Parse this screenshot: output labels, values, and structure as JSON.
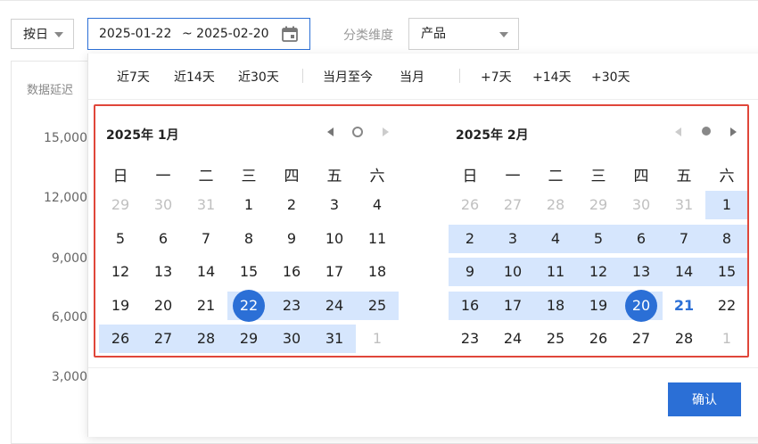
{
  "filter_bar": {
    "granularity": "按日",
    "date_start": "2025-01-22",
    "date_end": "~ 2025-02-20",
    "dimension_label": "分类维度",
    "dimension_value": "产品"
  },
  "background": {
    "card_title": "数据延迟",
    "y_ticks": [
      "15,000",
      "12,000",
      "9,000",
      "6,000",
      "3,000"
    ]
  },
  "picker": {
    "quick_ranges": [
      "近7天",
      "近14天",
      "近30天",
      "当月至今",
      "当月",
      "+7天",
      "+14天",
      "+30天"
    ],
    "weekdays": [
      "日",
      "一",
      "二",
      "三",
      "四",
      "五",
      "六"
    ],
    "confirm_label": "确认",
    "months": [
      {
        "title": "2025年 1月",
        "weeks": [
          [
            "29",
            "30",
            "31",
            "1",
            "2",
            "3",
            "4"
          ],
          [
            "5",
            "6",
            "7",
            "8",
            "9",
            "10",
            "11"
          ],
          [
            "12",
            "13",
            "14",
            "15",
            "16",
            "17",
            "18"
          ],
          [
            "19",
            "20",
            "21",
            "22",
            "23",
            "24",
            "25"
          ],
          [
            "26",
            "27",
            "28",
            "29",
            "30",
            "31",
            "1"
          ]
        ]
      },
      {
        "title": "2025年 2月",
        "weeks": [
          [
            "26",
            "27",
            "28",
            "29",
            "30",
            "31",
            "1"
          ],
          [
            "2",
            "3",
            "4",
            "5",
            "6",
            "7",
            "8"
          ],
          [
            "9",
            "10",
            "11",
            "12",
            "13",
            "14",
            "15"
          ],
          [
            "16",
            "17",
            "18",
            "19",
            "20",
            "21",
            "22"
          ],
          [
            "23",
            "24",
            "25",
            "26",
            "27",
            "28",
            "1"
          ]
        ]
      }
    ]
  },
  "colors": {
    "accent": "#2b6fd6",
    "range_fill": "#d6e6fd",
    "highlight_border": "#e0463a"
  }
}
